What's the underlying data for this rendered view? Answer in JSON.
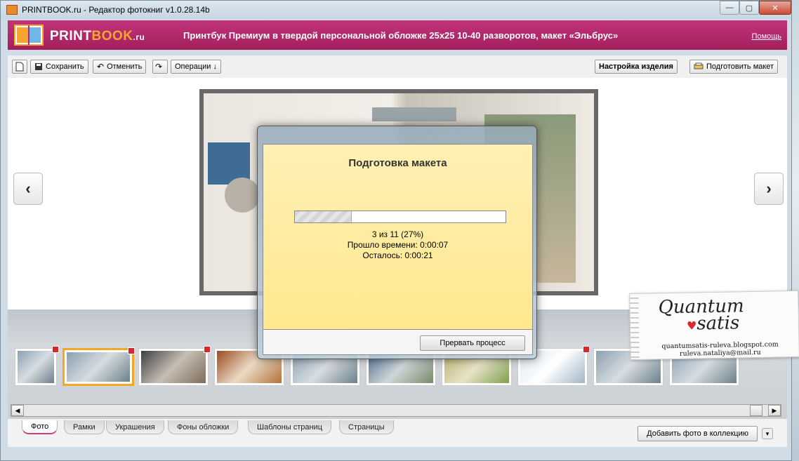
{
  "window": {
    "title": "PRINTBOOK.ru - Редактор фотокниг v1.0.28.14b",
    "controls": {
      "minimize": "—",
      "maximize": "▢",
      "close": "✕"
    }
  },
  "header": {
    "logo_print": "PRINT",
    "logo_book": "BOOK",
    "logo_ru": ".ru",
    "title": "Принтбук Премиум в твердой персональной обложке 25x25 10-40 разворотов, макет «Эльбрус»",
    "help": "Помощь",
    "colors": {
      "brand": "#b52a6b",
      "accent": "#f7a431"
    }
  },
  "toolbar": {
    "new_icon": "new-document-icon",
    "save": "Сохранить",
    "undo": "Отменить",
    "redo_icon": "redo-icon",
    "operations": "Операции ↓",
    "product_settings": "Настройка изделия",
    "prepare_layout": "Подготовить макет"
  },
  "navigation": {
    "prev": "‹",
    "next": "›"
  },
  "modal": {
    "title": "Подготовка макета",
    "progress": {
      "done": 3,
      "total": 11,
      "percent": 27
    },
    "progress_text": "3 из 11 (27%)",
    "elapsed": "Прошло времени: 0:00:07",
    "remaining": "Осталось: 0:00:21",
    "cancel": "Прервать процесс"
  },
  "thumbnails": [
    {
      "selected": false,
      "removable": true
    },
    {
      "selected": true,
      "removable": true
    },
    {
      "selected": false,
      "removable": true
    },
    {
      "selected": false,
      "removable": false
    },
    {
      "selected": false,
      "removable": false
    },
    {
      "selected": false,
      "removable": false
    },
    {
      "selected": false,
      "removable": false
    },
    {
      "selected": false,
      "removable": true
    },
    {
      "selected": false,
      "removable": false
    },
    {
      "selected": false,
      "removable": false
    }
  ],
  "tabs": [
    {
      "label": "Фото",
      "active": true
    },
    {
      "label": "Рамки",
      "active": false
    },
    {
      "label": "Украшения",
      "active": false
    },
    {
      "label": "Фоны обложки",
      "active": false
    },
    {
      "label": "Шаблоны страниц",
      "active": false
    },
    {
      "label": "Страницы",
      "active": false
    }
  ],
  "add_to_collection": "Добавить фото в коллекцию",
  "watermark": {
    "script_line1": "Quantum",
    "script_line2": "satis",
    "blog": "quantumsatis-ruleva.blogspot.com",
    "email": "ruleva.nataliya@mail.ru"
  }
}
